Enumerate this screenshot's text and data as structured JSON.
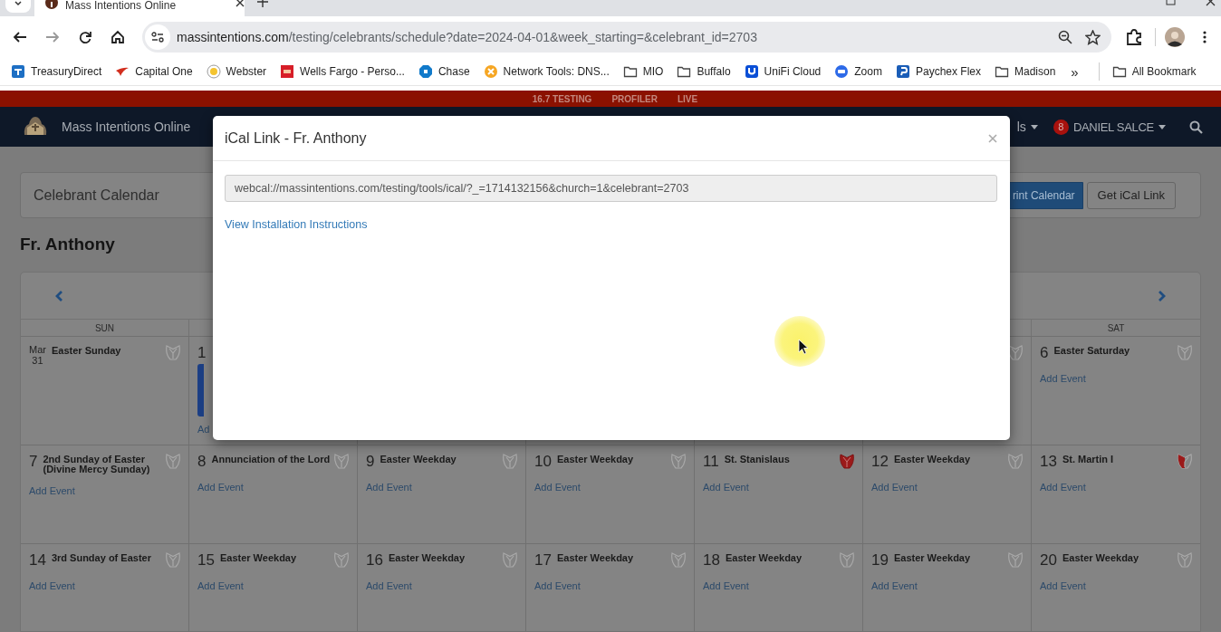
{
  "browser": {
    "tab": {
      "title": "Mass Intentions Online"
    },
    "address": {
      "domain": "massintentions.com",
      "path": "/testing/celebrants/schedule?date=2024-04-01&week_starting=&celebrant_id=2703"
    },
    "bookmarks": [
      {
        "label": "TreasuryDirect",
        "kind": "td"
      },
      {
        "label": "Capital One",
        "kind": "capitalone"
      },
      {
        "label": "Webster",
        "kind": "webster"
      },
      {
        "label": "Wells Fargo - Perso...",
        "kind": "wellsfargo"
      },
      {
        "label": "Chase",
        "kind": "chase"
      },
      {
        "label": "Network Tools: DNS...",
        "kind": "nettools"
      },
      {
        "label": "MIO",
        "kind": "folder"
      },
      {
        "label": "Buffalo",
        "kind": "folder"
      },
      {
        "label": "UniFi Cloud",
        "kind": "unifi"
      },
      {
        "label": "Zoom",
        "kind": "zoom"
      },
      {
        "label": "Paychex Flex",
        "kind": "paychex"
      },
      {
        "label": "Madison",
        "kind": "folder"
      }
    ],
    "more": "»",
    "all_bookmarks": "All Bookmark"
  },
  "env_bar": [
    "16.7 TESTING",
    "PROFILER",
    "LIVE"
  ],
  "navbar": {
    "brand": "Mass Intentions Online",
    "menu_fragment": "ls",
    "notifications": "8",
    "user": "DANIEL SALCE"
  },
  "header": {
    "title": "Celebrant Calendar",
    "print_button": "rint Calendar",
    "ical_button": "Get iCal Link"
  },
  "celebrant": "Fr. Anthony",
  "calendar": {
    "day_headers": {
      "first": "SUN",
      "last": "SAT"
    },
    "weeks": [
      {
        "cells": [
          {
            "month": "Mar",
            "day": "31",
            "title": "Easter Sunday",
            "red_vestment": false
          },
          {
            "day": "1",
            "has_event": true,
            "add_event": "Ad"
          },
          {},
          {},
          {},
          {
            "red_vestment": false
          },
          {
            "day": "6",
            "title": "Easter Saturday",
            "red_vestment": false,
            "add_event": "Add Event"
          }
        ]
      },
      {
        "cells": [
          {
            "day": "7",
            "title": "2nd Sunday of Easter (Divine Mercy Sunday)",
            "red_vestment": false,
            "add_event": "Add Event"
          },
          {
            "day": "8",
            "title": "Annunciation of the Lord",
            "red_vestment": false,
            "add_event": "Add Event"
          },
          {
            "day": "9",
            "title": "Easter Weekday",
            "red_vestment": false,
            "add_event": "Add Event"
          },
          {
            "day": "10",
            "title": "Easter Weekday",
            "red_vestment": false,
            "add_event": "Add Event"
          },
          {
            "day": "11",
            "title": "St. Stanislaus",
            "red_vestment": true,
            "add_event": "Add Event"
          },
          {
            "day": "12",
            "title": "Easter Weekday",
            "red_vestment": false,
            "add_event": "Add Event"
          },
          {
            "day": "13",
            "title": "St. Martin I",
            "red_vestment": true,
            "half_red": true,
            "add_event": "Add Event"
          }
        ]
      },
      {
        "cells": [
          {
            "day": "14",
            "title": "3rd Sunday of Easter",
            "red_vestment": false,
            "add_event": "Add Event"
          },
          {
            "day": "15",
            "title": "Easter Weekday",
            "red_vestment": false,
            "add_event": "Add Event"
          },
          {
            "day": "16",
            "title": "Easter Weekday",
            "red_vestment": false,
            "add_event": "Add Event"
          },
          {
            "day": "17",
            "title": "Easter Weekday",
            "red_vestment": false,
            "add_event": "Add Event"
          },
          {
            "day": "18",
            "title": "Easter Weekday",
            "red_vestment": false,
            "add_event": "Add Event"
          },
          {
            "day": "19",
            "title": "Easter Weekday",
            "red_vestment": false,
            "add_event": "Add Event"
          },
          {
            "day": "20",
            "title": "Easter Weekday",
            "red_vestment": false,
            "add_event": "Add Event"
          }
        ]
      }
    ]
  },
  "modal": {
    "title": "iCal Link - Fr. Anthony",
    "url": "webcal://massintentions.com/testing/tools/ical/?_=1714132156&church=1&celebrant=2703",
    "link": "View Installation Instructions"
  }
}
